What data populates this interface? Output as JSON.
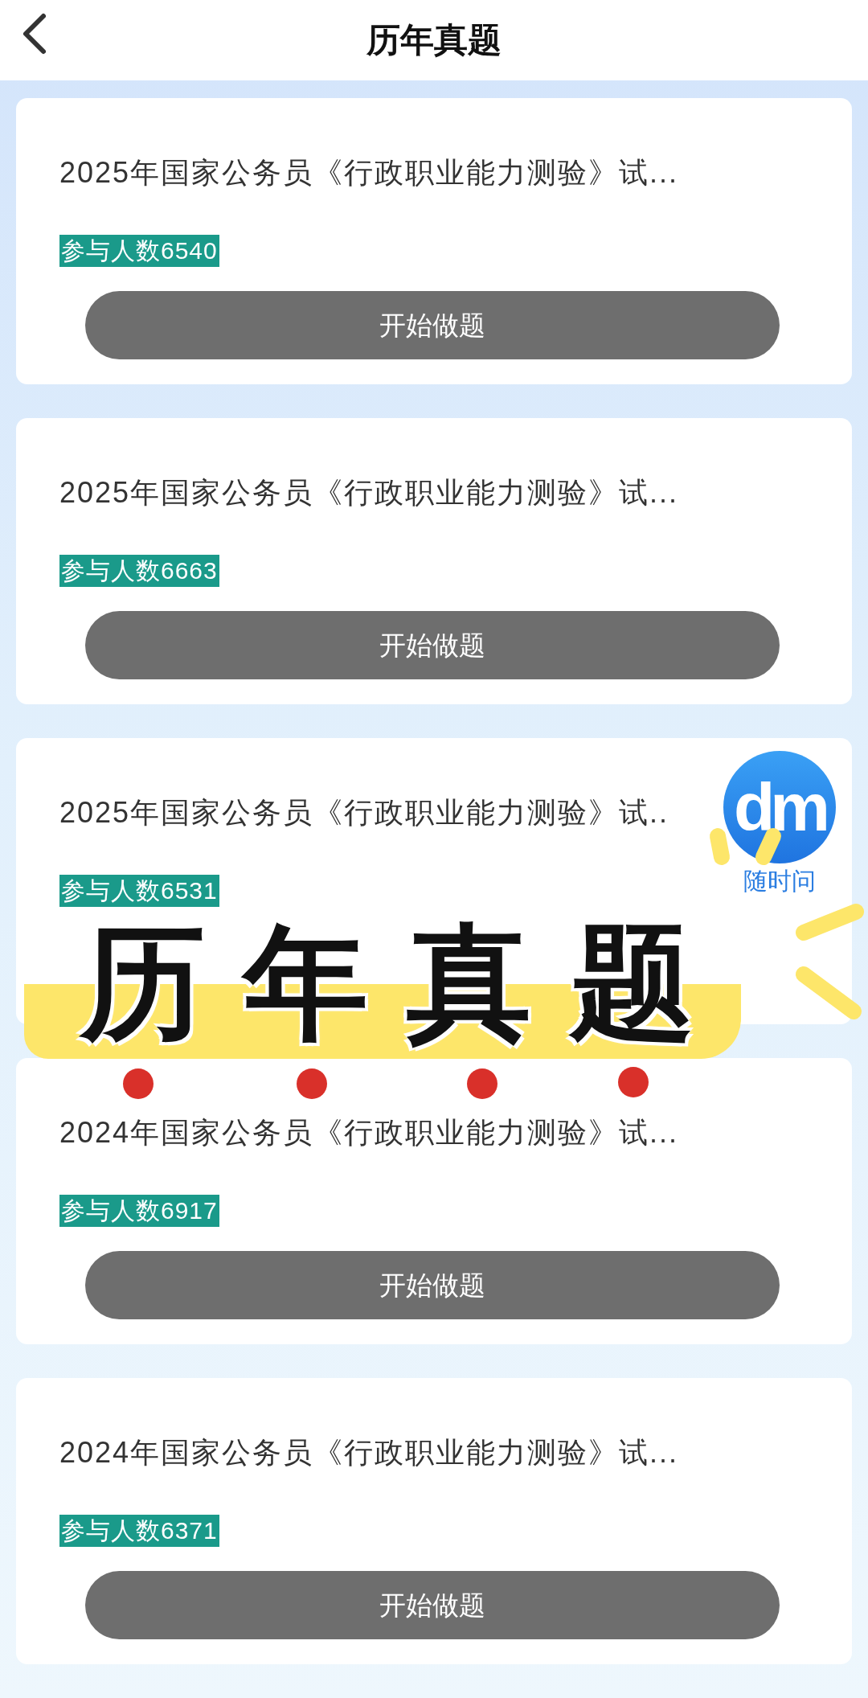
{
  "header": {
    "title": "历年真题"
  },
  "papers": [
    {
      "title": "2025年国家公务员《行政职业能力测验》试...",
      "participants": "参与人数6540",
      "button": "开始做题"
    },
    {
      "title": "2025年国家公务员《行政职业能力测验》试...",
      "participants": "参与人数6663",
      "button": "开始做题"
    },
    {
      "title": "2025年国家公务员《行政职业能力测验》试..",
      "participants": "参与人数6531"
    },
    {
      "title": "2024年国家公务员《行政职业能力测验》试...",
      "participants": "参与人数6917",
      "button": "开始做题"
    },
    {
      "title": "2024年国家公务员《行政职业能力测验》试...",
      "participants": "参与人数6371",
      "button": "开始做题"
    }
  ],
  "assistant": {
    "logo": "dm",
    "label": "随时问"
  },
  "sticker": {
    "text": "历年真题"
  }
}
